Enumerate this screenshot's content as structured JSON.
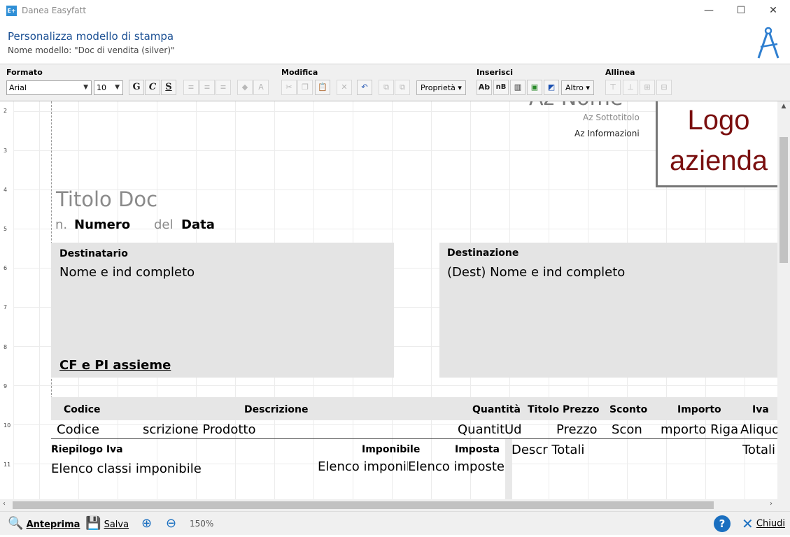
{
  "window": {
    "title": "Danea Easyfatt",
    "app_icon": "E+",
    "minimize": "—",
    "maximize": "☐",
    "close": "✕"
  },
  "header": {
    "title": "Personalizza modello di stampa",
    "subtitle": "Nome modello:  \"Doc di vendita (silver)\"",
    "icon": "compass-icon"
  },
  "toolbar": {
    "formato": {
      "label": "Formato",
      "font": "Arial",
      "size": "10",
      "bold": "G",
      "italic": "C",
      "underline": "S"
    },
    "modifica": {
      "label": "Modifica",
      "properties": "Proprietà"
    },
    "inserisci": {
      "label": "Inserisci",
      "text_field": "Ab",
      "other": "Altro"
    },
    "allinea": {
      "label": "Allinea"
    }
  },
  "ruler": {
    "marks": [
      "2",
      "3",
      "4",
      "5",
      "6",
      "7",
      "8",
      "9",
      "10",
      "11"
    ]
  },
  "document": {
    "company_name": "Az Nome",
    "company_subtitle": "Az Sottotitolo",
    "company_info": "Az Informazioni",
    "logo": "Logo azienda",
    "doc_title": "Titolo Doc",
    "number_prefix": "n.",
    "number": "Numero",
    "date_prefix": "del",
    "date": "Data",
    "recipient": {
      "label": "Destinatario",
      "name": "Nome e ind completo",
      "tax": "CF e PI assieme"
    },
    "destination": {
      "label": "Destinazione",
      "name": "(Dest) Nome e ind completo"
    },
    "table": {
      "headers": [
        "Codice",
        "Descrizione",
        "Quantità",
        "Titolo Prezzo",
        "Sconto",
        "Importo",
        "Iva"
      ],
      "row": [
        "Codice",
        "scrizione Prodotto",
        "Quantit",
        "Ud",
        "Prezzo",
        "Scon",
        "mporto Riga",
        "Aliquot"
      ]
    },
    "summary": {
      "label": "Riepilogo Iva",
      "taxable_label": "Imponibile",
      "tax_label": "Imposta",
      "classes": "Elenco classi imponibile",
      "taxable_list": "Elenco imponib",
      "tax_list": "Elenco imposte",
      "totals_desc": "Descr Totali",
      "totals": "Totali"
    }
  },
  "statusbar": {
    "preview": "Anteprima",
    "save": "Salva",
    "zoom": "150%",
    "close": "Chiudi"
  }
}
